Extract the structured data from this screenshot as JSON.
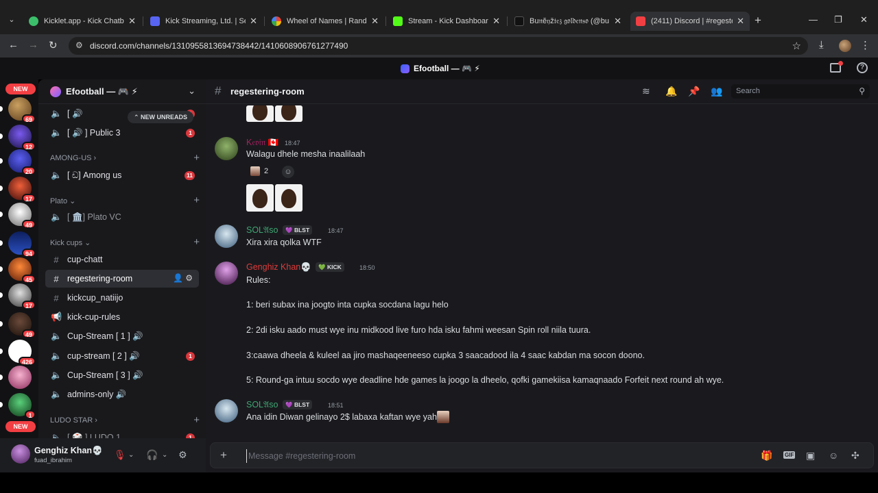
{
  "browser": {
    "tabs": [
      {
        "title": "Kicklet.app - Kick Chatbot",
        "color": "#3cbf6a"
      },
      {
        "title": "Kick Streaming, Ltd. | Set u",
        "color": "#5865f2"
      },
      {
        "title": "Wheel of Names | Random",
        "color": "#ea4335"
      },
      {
        "title": "Stream - Kick Dashboard",
        "color": "#53fc18"
      },
      {
        "title": "Bu𝔫ĕ𝔶ž𝔱𝔢𝔷 𝔤𝔬𝔩𝔡𝔢𝔫𝔰𝔬 (@bu",
        "color": "#111111"
      },
      {
        "title": "(2411) Discord | #regesteri",
        "color": "#f23f43"
      }
    ],
    "url": "discord.com/channels/1310955813694738442/1410608906761277490"
  },
  "app": {
    "title": "Efootball — 🎮 ⚡"
  },
  "servers": [
    {
      "badge": "",
      "color": "#7a4a2a"
    },
    {
      "badge": "69",
      "color": "#8a5a30"
    },
    {
      "badge": "12",
      "color": "#4b3b8f"
    },
    {
      "badge": "20",
      "color": "#3a3dbb"
    },
    {
      "badge": "17",
      "color": "#b33a2a"
    },
    {
      "badge": "49",
      "color": "#d8d8d8"
    },
    {
      "badge": "94",
      "color": "#1c2f7a"
    },
    {
      "badge": "45",
      "color": "#c2491d"
    },
    {
      "badge": "17",
      "color": "#8a8a8a"
    },
    {
      "badge": "49",
      "color": "#5a3a2a"
    },
    {
      "badge": "426",
      "color": "#ffffff"
    },
    {
      "badge": "",
      "color": "#e07aa0"
    },
    {
      "badge": "1",
      "color": "#2a7a3a"
    }
  ],
  "new_label": "NEW",
  "sidebar": {
    "server_name": "Efootball — 🎮 ⚡",
    "new_unreads": "NEW UNREADS",
    "channels": [
      {
        "name": "[ 🔊",
        "badge": "1"
      },
      {
        "name": "[ 🔊 ] Public 3",
        "badge": "1"
      },
      {
        "category": "AMONG-US ›"
      },
      {
        "name": "[ ඩ] Among us",
        "badge": "11"
      },
      {
        "category": "Plato ⌄"
      },
      {
        "name": "[ 🏛️] Plato VC",
        "badge": ""
      },
      {
        "category": "Kick cups ⌄"
      },
      {
        "name": "cup-chatt",
        "badge": ""
      },
      {
        "name": "regestering-room",
        "badge": ""
      },
      {
        "name": "kickcup_natiijo",
        "badge": ""
      },
      {
        "name": "kick-cup-rules",
        "badge": ""
      },
      {
        "name": "Cup-Stream [ 1 ] 🔊",
        "badge": ""
      },
      {
        "name": "cup-stream [ 2 ] 🔊",
        "badge": "1"
      },
      {
        "name": "Cup-Stream [ 3 ] 🔊",
        "badge": ""
      },
      {
        "name": "admins-only 🔊",
        "badge": ""
      },
      {
        "category": "LUDO STAR ›"
      },
      {
        "name": "[ 🎲 ] LUDO 1",
        "badge": "1"
      }
    ]
  },
  "user": {
    "name": "Genghiz Khan💀",
    "username": "fuad_ibrahim"
  },
  "channel": {
    "name": "regestering-room",
    "search_placeholder": "Search"
  },
  "messages": [
    {
      "author": "K𝔢𝔳𝔦𝔫 🇨🇦",
      "author_color": "#a3215f",
      "time": "18:47",
      "text": "Walagu dhele mesha inaalilaah",
      "reaction_count": "2"
    },
    {
      "author": "SOL𝔄so",
      "author_color": "#3fa773",
      "tag": "💜 BLST",
      "time": "18:47",
      "text": "Xira xira qolka WTF"
    },
    {
      "author": "Genghiz Khan💀",
      "author_color": "#e03b3b",
      "tag": "💚 KICK",
      "time": "18:50",
      "lines": [
        "Rules:",
        "1: beri subax ina joogto inta cupka socdana lagu helo",
        "2: 2di isku aado must wye inu midkood live furo hda isku fahmi weesan Spin roll niila tuura.",
        "3:caawa dheela & kuleel aa jiro mashaqeeneeso cupka 3 saacadood ila 4 saac kabdan ma socon doono.",
        "5: Round-ga intuu socdo wye deadline hde games la joogo la dheelo, qofki gamekiisa kamaqnaado Forfeit next round ah wye."
      ]
    },
    {
      "author": "SOL𝔄so",
      "author_color": "#3fa773",
      "tag": "💜 BLST",
      "time": "18:51",
      "text": "Ana idin Diwan gelinayo 2$ labaxa kaftan wye yah"
    }
  ],
  "composer": {
    "placeholder": "Message #regestering-room"
  }
}
